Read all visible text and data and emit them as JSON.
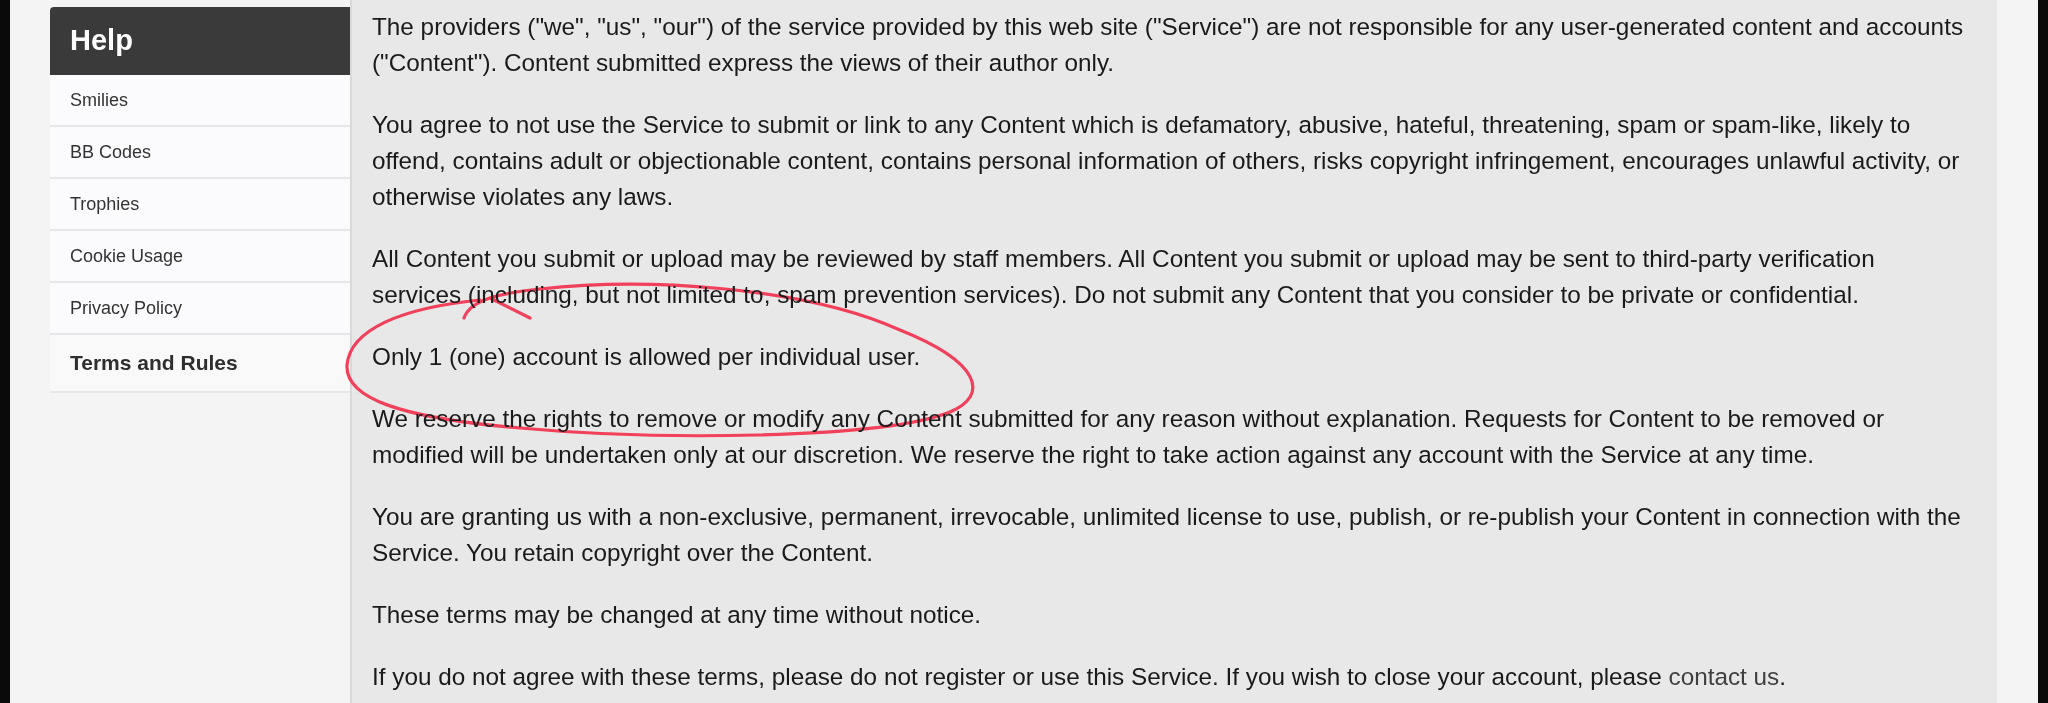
{
  "sidebar": {
    "title": "Help",
    "items": [
      {
        "label": "Smilies",
        "selected": false
      },
      {
        "label": "BB Codes",
        "selected": false
      },
      {
        "label": "Trophies",
        "selected": false
      },
      {
        "label": "Cookie Usage",
        "selected": false
      },
      {
        "label": "Privacy Policy",
        "selected": false
      },
      {
        "label": "Terms and Rules",
        "selected": true
      }
    ]
  },
  "content": {
    "paragraphs": [
      {
        "text": "The providers (\"we\", \"us\", \"our\") of the service provided by this web site (\"Service\") are not responsible for any user-generated content and accounts (\"Content\"). Content submitted express the views of their author only."
      },
      {
        "text": "You agree to not use the Service to submit or link to any Content which is defamatory, abusive, hateful, threatening, spam or spam-like, likely to offend, contains adult or objectionable content, contains personal information of others, risks copyright infringement, encourages unlawful activity, or otherwise violates any laws."
      },
      {
        "text": "All Content you submit or upload may be reviewed by staff members. All Content you submit or upload may be sent to third-party verification services (including, but not limited to, spam prevention services). Do not submit any Content that you consider to be private or confidential."
      },
      {
        "text": "Only 1 (one) account is allowed per individual user."
      },
      {
        "text": "We reserve the rights to remove or modify any Content submitted for any reason without explanation. Requests for Content to be removed or modified will be undertaken only at our discretion. We reserve the right to take action against any account with the Service at any time."
      },
      {
        "text": "You are granting us with a non-exclusive, permanent, irrevocable, unlimited license to use, publish, or re-publish your Content in connection with the Service. You retain copyright over the Content."
      },
      {
        "text": "These terms may be changed at any time without notice."
      },
      {
        "text": "If you do not agree with these terms, please do not register or use this Service. If you wish to close your account, please ",
        "link": "contact us",
        "after": "."
      }
    ]
  }
}
